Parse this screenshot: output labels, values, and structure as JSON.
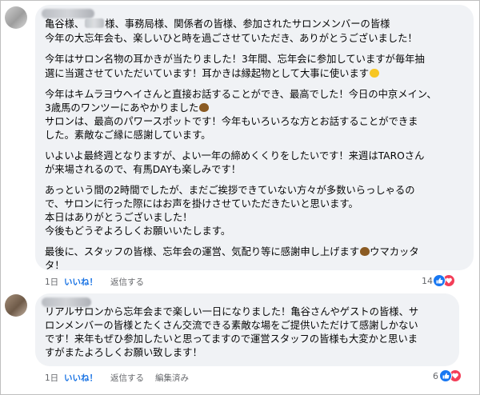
{
  "comments": [
    {
      "greeting_parts": [
        "亀谷様、",
        "様、事務局様、関係者の皆様、参加されたサロンメンバーの皆様"
      ],
      "lines": [
        "今年の大忘年会も、楽しいひと時を過ごさせていただき、ありがとうございました！",
        "今年はサロン名物の耳かきが当たりました！3年間、忘年会に参加していますが毎年抽",
        "選に当選させていただいています！耳かきは縁起物として大事に使います",
        "今年はキムラヨウヘイさんと直接お話することができ、最高でした！今日の中京メイン、",
        "3歳馬のワンツーにあやかりました",
        "サロンは、最高のパワースポットです！今年もいろいろな方とお話することができま",
        "した。素敵なご縁に感謝しています。",
        "いよいよ最終週となりますが、よい一年の締めくくりをしたいです！来週はTAROさん",
        "が来場されるので、有馬DAYも楽しみです！",
        "あっという間の2時間でしたが、まだご挨拶できていない方々が多数いらっしゃるの",
        "で、サロンに行った際にはお声を掛けさせていただきたいと思います。",
        "本日はありがとうございました！",
        "今後もどうぞよろしくお願いいたします。",
        "最後に、スタッフの皆様、忘年会の運営、気配り等に感謝申し上げます",
        "ウマカッタ",
        "タ！"
      ],
      "time": "1日",
      "like_label": "いいね！",
      "reply_label": "返信する",
      "reaction_count": "14",
      "emoji_icons": [
        "grinning-face-icon",
        "poop-icon"
      ]
    },
    {
      "lines": [
        "リアルサロンから忘年会まで楽しい一日になりました！亀谷さんやゲストの皆様、サ",
        "ロンメンバーの皆様とたくさん交流できる素敵な場をご提供いただけて感謝しかない",
        "です！来年もぜひ参加したいと思ってますので運営スタッフの皆様も大変かと思いま",
        "すがまたよろしくお願い致します！"
      ],
      "time": "1日",
      "like_label": "いいね！",
      "reply_label": "返信する",
      "edited_label": "編集済み",
      "reaction_count": "6"
    }
  ],
  "colors": {
    "bubble": "#f0f2f5",
    "like": "#1b74e4",
    "meta": "#65676b",
    "reaction_like": "#1877f2",
    "reaction_love": "#f33e58"
  }
}
